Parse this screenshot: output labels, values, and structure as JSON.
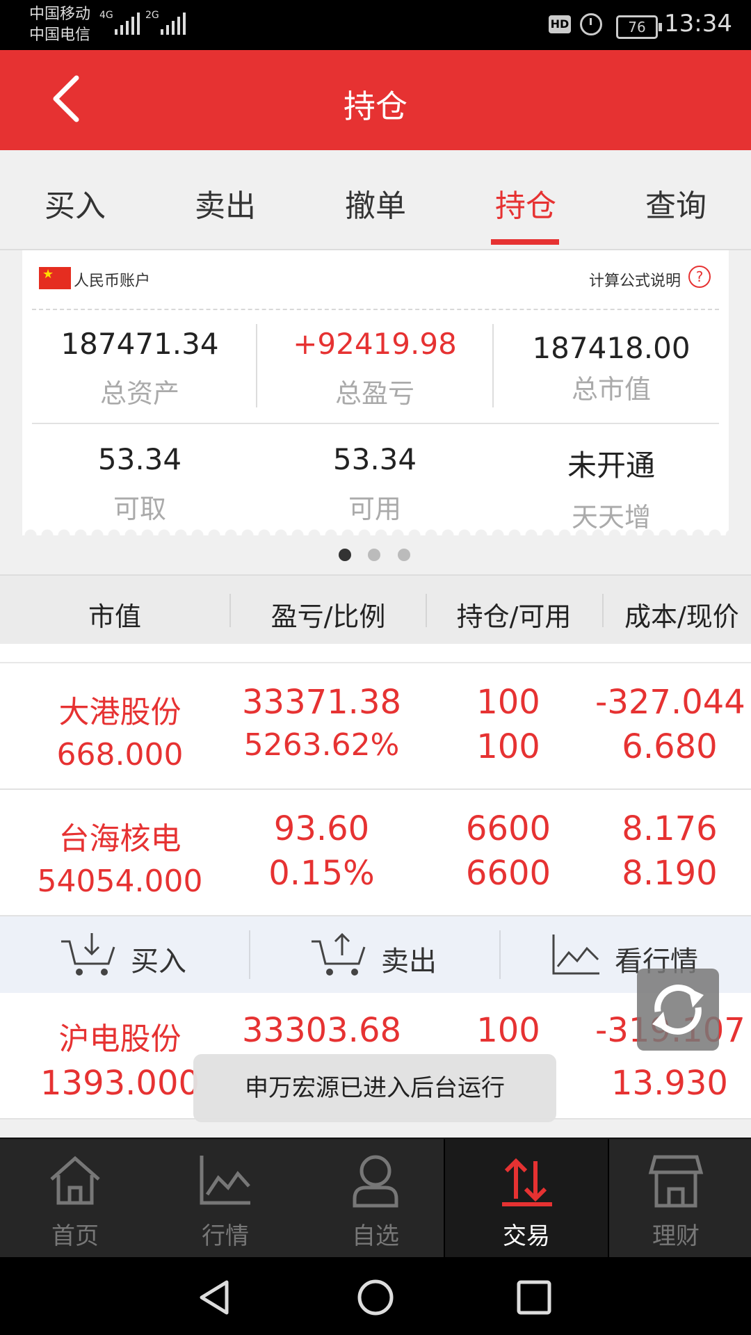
{
  "status_bar": {
    "carrier1": "中国移动",
    "carrier2": "中国电信",
    "net1": "4G",
    "net2": "2G",
    "hd": "HD",
    "battery": "76",
    "time": "13:34"
  },
  "header": {
    "title": "持仓",
    "back_icon": "chevron-left-icon"
  },
  "tabs": [
    {
      "label": "买入"
    },
    {
      "label": "卖出"
    },
    {
      "label": "撤单"
    },
    {
      "label": "持仓",
      "active": true
    },
    {
      "label": "查询"
    }
  ],
  "account": {
    "currency_label": "人民币账户",
    "formula_label": "计算公式说明",
    "help_icon": "?",
    "row1": [
      {
        "value": "187471.34",
        "label": "总资产"
      },
      {
        "value": "+92419.98",
        "label": "总盈亏",
        "color": "#e63232"
      },
      {
        "value": "187418.00",
        "label": "总市值"
      }
    ],
    "row2": [
      {
        "value": "53.34",
        "label": "可取"
      },
      {
        "value": "53.34",
        "label": "可用"
      },
      {
        "value": "未开通",
        "label": "天天增"
      }
    ]
  },
  "pager": {
    "total": 3,
    "active": 0
  },
  "table": {
    "headers": [
      "市值",
      "盈亏/比例",
      "持仓/可用",
      "成本/现价"
    ],
    "rows": [
      {
        "name": "大港股份",
        "market_value": "668.000",
        "pnl": "33371.38",
        "pnl_ratio": "5263.62%",
        "holding": "100",
        "available": "100",
        "cost": "-327.044",
        "price": "6.680"
      },
      {
        "name": "台海核电",
        "market_value": "54054.000",
        "pnl": "93.60",
        "pnl_ratio": "0.15%",
        "holding": "6600",
        "available": "6600",
        "cost": "8.176",
        "price": "8.190"
      },
      {
        "name": "沪电股份",
        "market_value": "1393.000",
        "pnl": "33303.68",
        "pnl_ratio": "",
        "holding": "100",
        "available": "",
        "cost": "-319.107",
        "price": "13.930"
      }
    ]
  },
  "actions": [
    {
      "label": "买入",
      "icon": "cart-in-icon"
    },
    {
      "label": "卖出",
      "icon": "cart-out-icon"
    },
    {
      "label": "看行情",
      "icon": "chart-icon"
    }
  ],
  "toast": "申万宏源已进入后台运行",
  "bottom_nav": [
    {
      "label": "首页",
      "icon": "home-icon"
    },
    {
      "label": "行情",
      "icon": "chart-icon"
    },
    {
      "label": "自选",
      "icon": "person-icon"
    },
    {
      "label": "交易",
      "icon": "trade-icon",
      "active": true
    },
    {
      "label": "理财",
      "icon": "shop-icon"
    }
  ],
  "colors": {
    "brand_red": "#e63232",
    "nav_bg": "#262626"
  }
}
